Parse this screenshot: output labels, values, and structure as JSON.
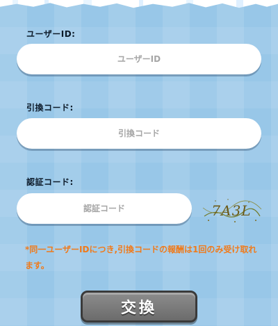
{
  "form": {
    "user_id_label": "ユーザーID:",
    "user_id_placeholder": "ユーザーID",
    "exchange_code_label": "引換コード:",
    "exchange_code_placeholder": "引換コード",
    "captcha_label": "認証コード:",
    "captcha_placeholder": "認証コード",
    "captcha_image_text": "7A3L"
  },
  "notice": "*同一ユーザーIDにつき,引換コードの報酬は1回のみ受け取れます。",
  "exchange_button_label": "交換",
  "colors": {
    "background": "#9ccaea",
    "notice": "#f07a1a",
    "button": "#7a7a7a"
  }
}
